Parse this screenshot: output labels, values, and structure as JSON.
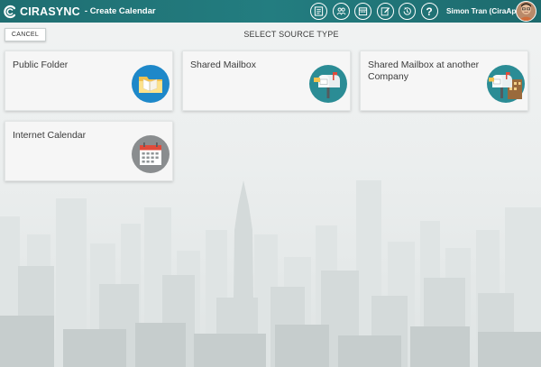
{
  "app": {
    "logo_text": "CIRASYNC",
    "page_name": "- Create Calendar",
    "colors": {
      "header": "#237d80",
      "accent_blue": "#1e88c9",
      "accent_teal": "#2b8c95"
    }
  },
  "toolbar": {
    "icons": [
      "dashboard-icon",
      "contacts-icon",
      "calendar-icon",
      "edit-icon",
      "history-icon",
      "help-icon"
    ],
    "help_label": "?"
  },
  "user": {
    "name": "Simon Tran (CiraApps)"
  },
  "actions": {
    "cancel_label": "CANCEL"
  },
  "main": {
    "title": "SELECT SOURCE TYPE",
    "cards": [
      {
        "label": "Public Folder",
        "icon": "folder-icon"
      },
      {
        "label": "Shared Mailbox",
        "icon": "mailbox-icon"
      },
      {
        "label": "Shared Mailbox at another Company",
        "icon": "mailbox-company-icon"
      },
      {
        "label": "Internet Calendar",
        "icon": "calendar-icon"
      }
    ]
  }
}
